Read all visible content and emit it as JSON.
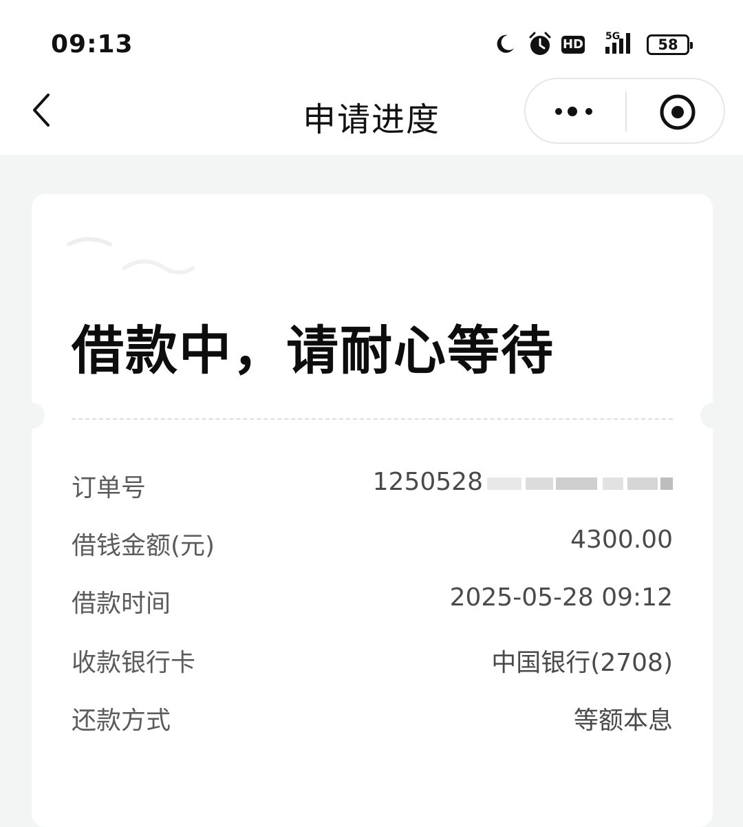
{
  "status_bar": {
    "time": "09:13",
    "network": "5G",
    "hd_label": "HD",
    "battery": "58",
    "icons": [
      "moon-icon",
      "alarm-icon",
      "hd-icon",
      "signal-icon",
      "battery-icon"
    ]
  },
  "nav": {
    "title": "申请进度",
    "back_icon": "chevron-left-icon",
    "more_icon": "more-dots-icon",
    "close_icon": "target-close-icon"
  },
  "status": {
    "headline": "借款中，请耐心等待"
  },
  "details": [
    {
      "label": "订单号",
      "value": "1250528"
    },
    {
      "label": "借钱金额(元)",
      "value": "4300.00"
    },
    {
      "label": "借款时间",
      "value": "2025-05-28 09:12"
    },
    {
      "label": "收款银行卡",
      "value": "中国银行(2708)"
    },
    {
      "label": "还款方式",
      "value": "等额本息"
    }
  ]
}
